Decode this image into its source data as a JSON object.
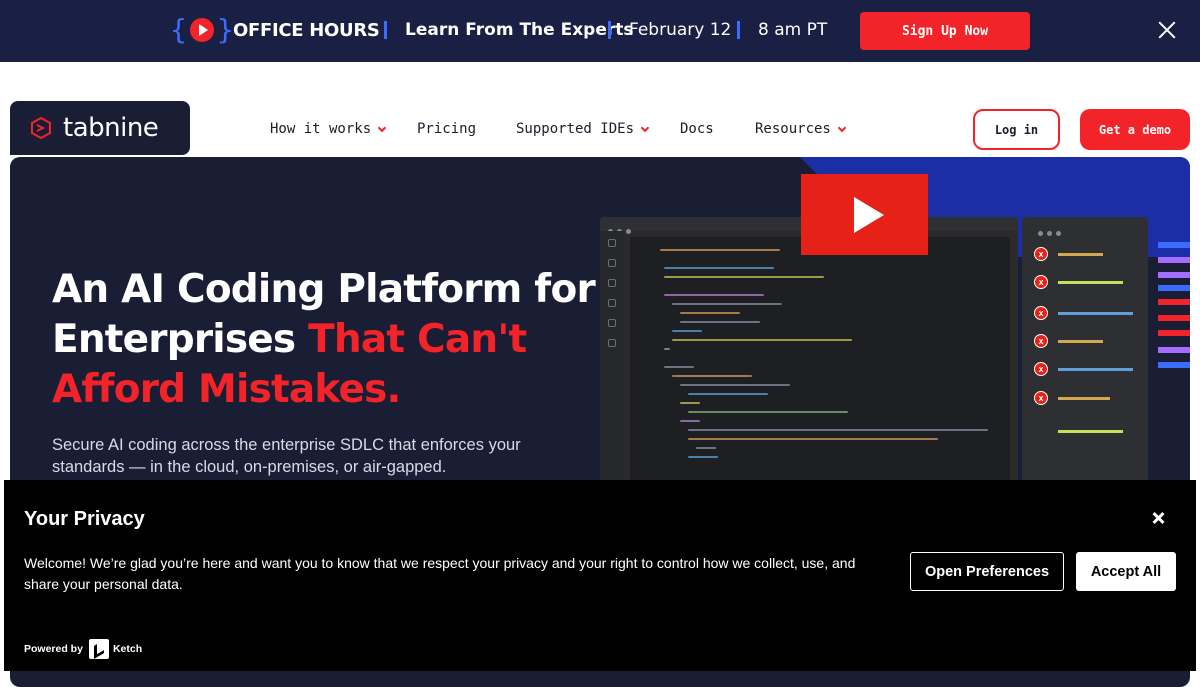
{
  "announcement": {
    "event_name": "OFFICE HOURS",
    "topic": "Learn From The Experts",
    "date": "February 12",
    "time": "8 am PT",
    "cta_label": "Sign Up Now",
    "accent": "#f3232a",
    "background": "#1a2043"
  },
  "nav": {
    "logo_text": "tabnine",
    "items": [
      {
        "label": "How it works",
        "has_dropdown": true
      },
      {
        "label": "Pricing",
        "has_dropdown": false
      },
      {
        "label": "Supported IDEs",
        "has_dropdown": true
      },
      {
        "label": "Docs",
        "has_dropdown": false
      },
      {
        "label": "Resources",
        "has_dropdown": true
      }
    ],
    "login_label": "Log in",
    "demo_label": "Get a demo"
  },
  "hero": {
    "title_white": "An AI Coding Platform for Enterprises",
    "title_red": "That Can't Afford Mistakes.",
    "subtitle": "Secure AI coding across the enterprise SDLC that enforces your standards — in the cloud, on-premises, or air-gapped.",
    "video_icon": "play-icon",
    "background": "#1a1e35"
  },
  "cookie": {
    "title": "Your Privacy",
    "message": "Welcome! We’re glad you’re here and want you to know that we respect your privacy and your right to control how we collect, use, and share your personal data.",
    "prefs_label": "Open Preferences",
    "accept_label": "Accept All",
    "powered_by": "Powered by",
    "provider": "Ketch"
  }
}
